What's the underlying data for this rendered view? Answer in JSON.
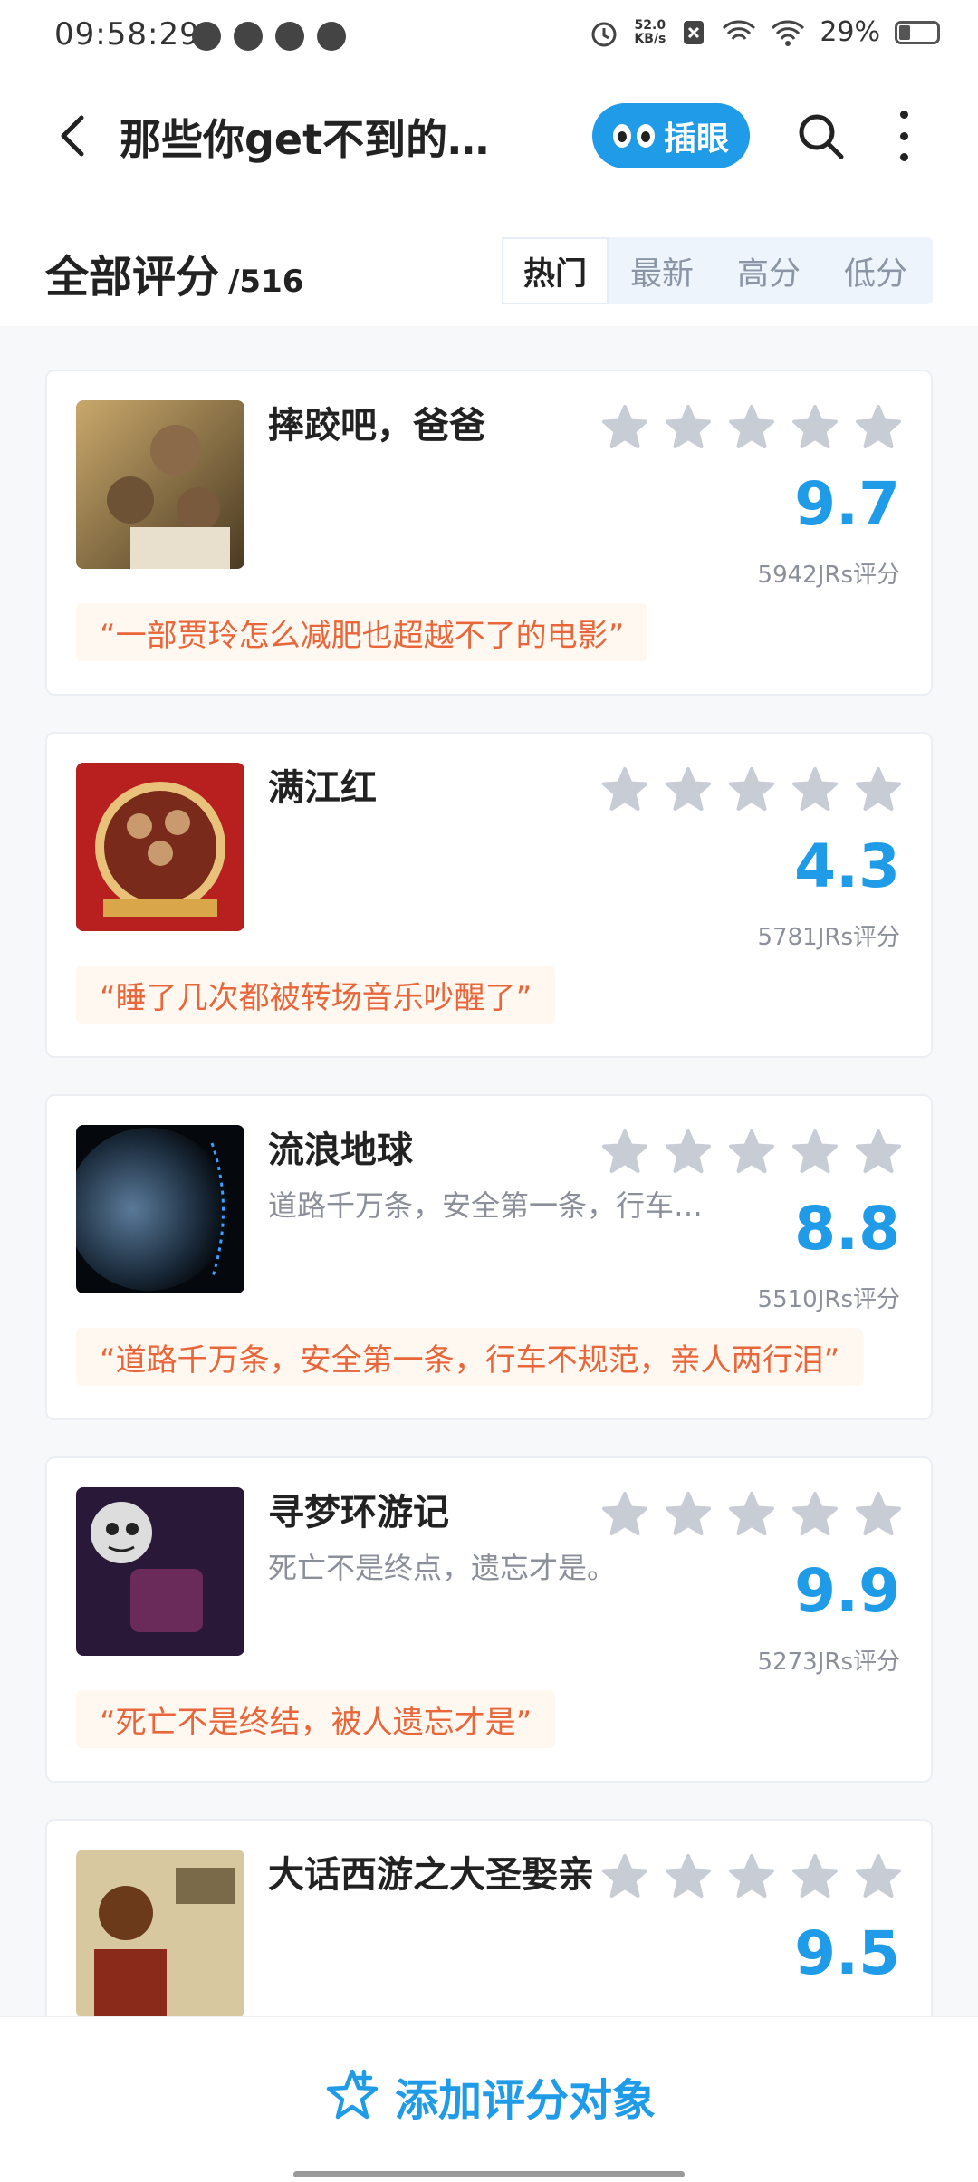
{
  "status_bar": {
    "time": "09:58:29",
    "net_speed_top": "52.0",
    "net_speed_unit": "KB/s",
    "battery": "29%"
  },
  "header": {
    "title": "那些你get不到的高…",
    "peek_label": "插眼"
  },
  "ratings": {
    "title": "全部评分",
    "count": "/516",
    "sort_tabs": [
      "热门",
      "最新",
      "高分",
      "低分"
    ],
    "active_sort": "热门"
  },
  "colors": {
    "accent": "#1f9be8",
    "quote_text": "#e8663a",
    "star_gray": "#c8ccd4"
  },
  "movies": [
    {
      "name": "摔跤吧，爸爸",
      "subtitle": "",
      "score": "9.7",
      "votes": "5942JRs评分",
      "quote": "“一部贾玲怎么减肥也超越不了的电影”"
    },
    {
      "name": "满江红",
      "subtitle": "",
      "score": "4.3",
      "votes": "5781JRs评分",
      "quote": "“睡了几次都被转场音乐吵醒了”"
    },
    {
      "name": "流浪地球",
      "subtitle": "道路千万条，安全第一条，行车…",
      "score": "8.8",
      "votes": "5510JRs评分",
      "quote": "“道路千万条，安全第一条，行车不规范，亲人两行泪”"
    },
    {
      "name": "寻梦环游记",
      "subtitle": "死亡不是终点，遗忘才是。",
      "score": "9.9",
      "votes": "5273JRs评分",
      "quote": "“死亡不是终结，被人遗忘才是”"
    },
    {
      "name": "大话西游之大圣娶亲",
      "subtitle": "",
      "score": "9.5",
      "votes": "",
      "quote": ""
    }
  ],
  "bottom": {
    "add_label": "添加评分对象"
  }
}
